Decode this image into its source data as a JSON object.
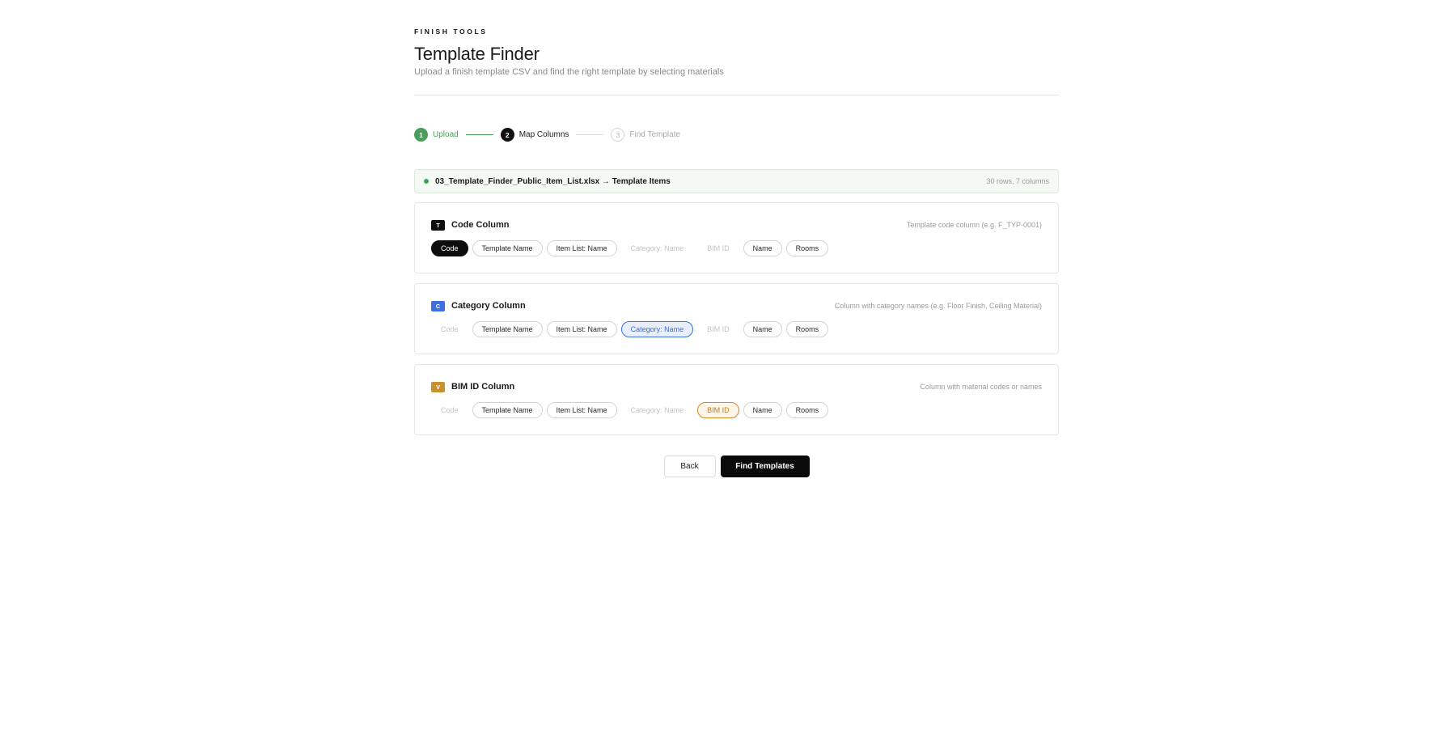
{
  "header": {
    "eyebrow": "FINISH TOOLS",
    "title": "Template Finder",
    "subtitle": "Upload a finish template CSV and find the right template by selecting materials"
  },
  "stepper": [
    {
      "number": "1",
      "label": "Upload",
      "state": "done"
    },
    {
      "number": "2",
      "label": "Map Columns",
      "state": "active"
    },
    {
      "number": "3",
      "label": "Find Template",
      "state": "pending"
    }
  ],
  "file": {
    "name": "03_Template_Finder_Public_Item_List.xlsx → Template Items",
    "meta": "30 rows, 7 columns"
  },
  "cards": [
    {
      "badge": "T",
      "badge_color": "#0d0d0d",
      "title": "Code Column",
      "hint": "Template code column (e.g. F_TYP-0001)",
      "chips": [
        {
          "label": "Code",
          "state": "selected"
        },
        {
          "label": "Template Name",
          "state": "normal"
        },
        {
          "label": "Item List: Name",
          "state": "normal"
        },
        {
          "label": "Category: Name",
          "state": "disabled"
        },
        {
          "label": "BIM ID",
          "state": "disabled"
        },
        {
          "label": "Name",
          "state": "normal"
        },
        {
          "label": "Rooms",
          "state": "normal"
        }
      ]
    },
    {
      "badge": "C",
      "badge_color": "#3d6fe0",
      "title": "Category Column",
      "hint": "Column with category names (e.g. Floor Finish, Ceiling Material)",
      "chips": [
        {
          "label": "Code",
          "state": "disabled"
        },
        {
          "label": "Template Name",
          "state": "normal"
        },
        {
          "label": "Item List: Name",
          "state": "normal"
        },
        {
          "label": "Category: Name",
          "state": "selected"
        },
        {
          "label": "BIM ID",
          "state": "disabled"
        },
        {
          "label": "Name",
          "state": "normal"
        },
        {
          "label": "Rooms",
          "state": "normal"
        }
      ]
    },
    {
      "badge": "V",
      "badge_color": "#c9912e",
      "title": "BIM ID Column",
      "hint": "Column with material codes or names",
      "chips": [
        {
          "label": "Code",
          "state": "disabled"
        },
        {
          "label": "Template Name",
          "state": "normal"
        },
        {
          "label": "Item List: Name",
          "state": "normal"
        },
        {
          "label": "Category: Name",
          "state": "disabled"
        },
        {
          "label": "BIM ID",
          "state": "selected"
        },
        {
          "label": "Name",
          "state": "normal"
        },
        {
          "label": "Rooms",
          "state": "normal"
        }
      ]
    }
  ],
  "actions": {
    "back_label": "Back",
    "primary_label": "Find Templates"
  }
}
